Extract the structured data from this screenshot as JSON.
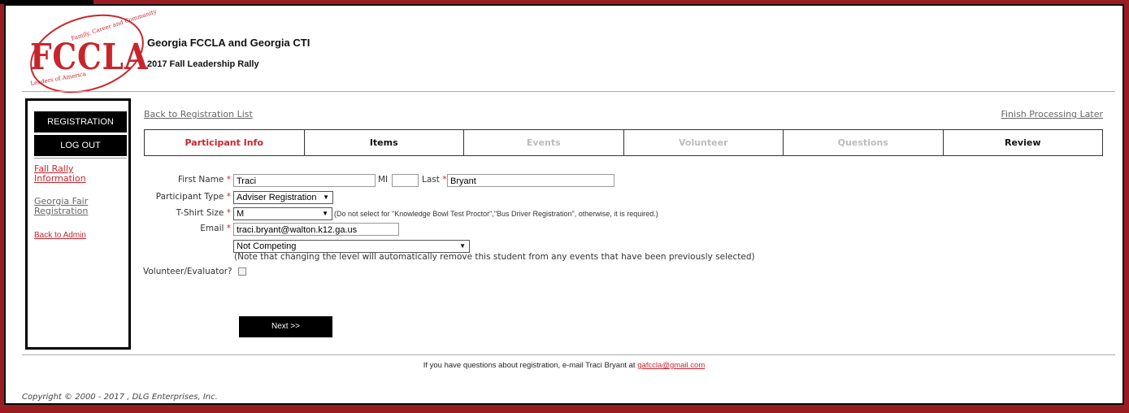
{
  "brand": {
    "logo_text": "FCCLA",
    "logo_top_text": "Family, Career and Community",
    "logo_bottom_text": "Leaders of America",
    "accent_color": "#c8252b",
    "frame_color": "#9b1c1f"
  },
  "header": {
    "org_title": "Georgia FCCLA and Georgia CTI",
    "event_title": "2017 Fall Leadership Rally"
  },
  "sidebar": {
    "registration_label": "REGISTRATION",
    "logout_label": "LOG OUT",
    "links": [
      {
        "label_line1": "Fall Rally",
        "label_line2": "Information",
        "state": "active"
      },
      {
        "label_line1": "Georgia Fair",
        "label_line2": "Registration",
        "state": "normal"
      },
      {
        "label": "Back to Admin",
        "state": "active"
      }
    ]
  },
  "nav": {
    "back_link": "Back to Registration List",
    "finish_link": "Finish Processing Later"
  },
  "tabs": [
    {
      "label": "Participant Info",
      "state": "active"
    },
    {
      "label": "Items",
      "state": "enabled"
    },
    {
      "label": "Events",
      "state": "disabled"
    },
    {
      "label": "Volunteer",
      "state": "disabled"
    },
    {
      "label": "Questions",
      "state": "disabled"
    },
    {
      "label": "Review",
      "state": "enabled"
    }
  ],
  "form": {
    "first_name_label": "First Name",
    "first_name_value": "Traci",
    "mi_label": "MI",
    "mi_value": "",
    "last_name_label": "Last",
    "last_name_value": "Bryant",
    "participant_type_label": "Participant Type",
    "participant_type_value": "Adviser Registration",
    "tshirt_label": "T-Shirt Size",
    "tshirt_value": "M",
    "tshirt_note": "(Do not select for \"Knowledge Bowl Test Proctor\",\"Bus Driver Registration\", otherwise, it is required.)",
    "email_label": "Email",
    "email_value": "traci.bryant@walton.k12.ga.us",
    "level_value": "Not Competing",
    "level_note": "(Note that changing the level will automatically remove this student from any events that have been previously selected)",
    "volunteer_label": "Volunteer/Evaluator?",
    "volunteer_checked": false,
    "required_mark": "*"
  },
  "actions": {
    "next_label": "Next >>"
  },
  "footer": {
    "question_text": "If you have questions about registration, e-mail Traci Bryant at",
    "contact_email": "gafccla@gmail.com",
    "copyright": "Copyright © 2000 - 2017 , DLG Enterprises, Inc."
  }
}
